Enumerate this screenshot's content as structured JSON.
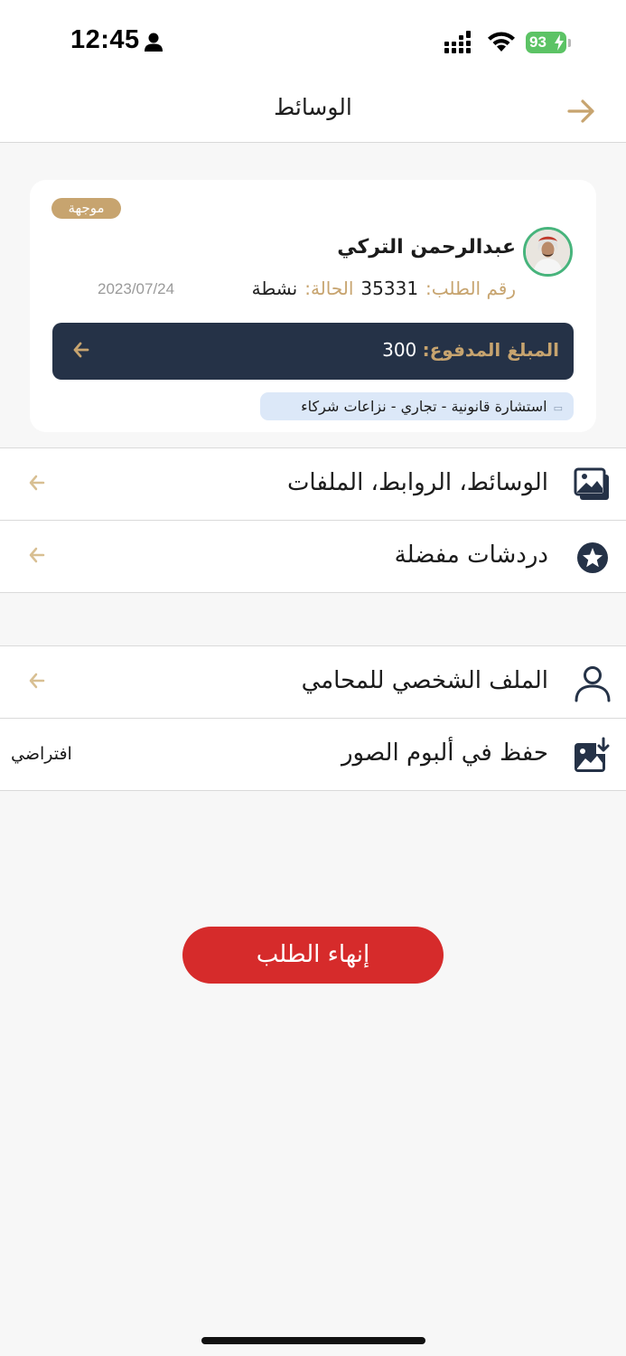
{
  "status_bar": {
    "time": "12:45",
    "battery": "93"
  },
  "nav": {
    "title": "الوسائط"
  },
  "card": {
    "badge": "موجهة",
    "lawyer_name": "عبدالرحمن التركي",
    "request_number_label": "رقم الطلب:",
    "request_number": "35331",
    "status_label": "الحالة:",
    "status_value": "نشطة",
    "date": "2023/07/24",
    "amount_label": "المبلغ المدفوع:",
    "amount_value": "300",
    "tag": "استشارة قانونية - تجاري - نزاعات شركاء"
  },
  "menu_group_1": [
    {
      "label": "الوسائط، الروابط، الملفات",
      "icon": "photo-gallery-icon"
    },
    {
      "label": "دردشات مفضلة",
      "icon": "star-circle-icon"
    }
  ],
  "menu_group_2": [
    {
      "label": "الملف الشخصي للمحامي",
      "icon": "person-outline-icon"
    },
    {
      "label": "حفظ في ألبوم الصور",
      "icon": "save-photo-icon",
      "value": "افتراضي"
    }
  ],
  "end_button": {
    "label": "إنهاء الطلب"
  },
  "colors": {
    "gold": "#c7a46f",
    "navy": "#253247",
    "red": "#d62b2b",
    "green": "#5cc365"
  }
}
